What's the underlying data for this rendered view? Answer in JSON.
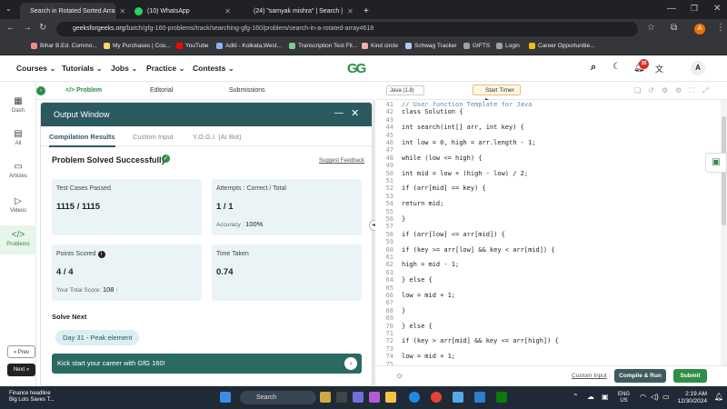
{
  "browser": {
    "tabs": [
      {
        "label": "Search in Rotated Sorted Arra",
        "icon": "gfg-favicon-icon",
        "active": true
      },
      {
        "label": "(10) WhatsApp",
        "icon": "whatsapp-icon",
        "active": false
      },
      {
        "label": "(24) \"samyak mishra\" | Search |",
        "icon": "linkedin-icon",
        "active": false
      }
    ],
    "new_tab": "+",
    "url_host": "geeksforgeeks.org",
    "url_path": "/batch/gfg-160-problems/track/searching-gfg-160/problem/search-in-a-rotated-array4618",
    "profile_initial": "A",
    "bookmarks": [
      "Bihar B.Ed. Commo...",
      "My Purchases | Cou...",
      "YouTube",
      "Aditi - Kolkata,West...",
      "Transcription Test Fil...",
      "Kind circle",
      "Schwag Tracker",
      "GIFTS",
      "Login",
      "Career Opportunitie..."
    ]
  },
  "header": {
    "menus": [
      "Courses ⌄",
      "Tutorials ⌄",
      "Jobs ⌄",
      "Practice ⌄",
      "Contests ⌄"
    ],
    "logo": "GG",
    "notif_count": "35",
    "avatar": "A"
  },
  "rail": {
    "items": [
      {
        "label": "Dash",
        "icon": "▦"
      },
      {
        "label": "All",
        "icon": "▤"
      },
      {
        "label": "Articles",
        "icon": "▭"
      },
      {
        "label": "Videos",
        "icon": "▷"
      },
      {
        "label": "Problems",
        "icon": "</>"
      }
    ],
    "prev": "« Prev",
    "next": "Next »"
  },
  "problem_tabs": [
    "</> Problem",
    "Editorial",
    "Submissions"
  ],
  "output": {
    "title": "Output Window",
    "tabs": [
      "Compilation Results",
      "Custom Input",
      "Y.O.G.I. (AI Bot)"
    ],
    "status": "Problem Solved Successfully",
    "feedback": "Suggest Feedback",
    "test_cases_label": "Test Cases Passed",
    "test_cases_value": "1115 / 1115",
    "attempts_label": "Attempts : Correct / Total",
    "attempts_value": "1 / 1",
    "accuracy_label": "Accuracy :",
    "accuracy_value": "100%",
    "points_label": "Points Scored",
    "points_value": "4 / 4",
    "total_score_label": "Your Total Score:",
    "total_score_value": "108",
    "time_label": "Time Taken",
    "time_value": "0.74",
    "solve_next": "Solve Next",
    "next_problem": "Day 31 - Peak element",
    "banner": "Kick start your career with GfG 160!"
  },
  "editor": {
    "language": "Java (1.8)",
    "timer": "Start Timer",
    "lines": [
      {
        "n": "41",
        "t": "// User function Template for Java",
        "c": true
      },
      {
        "n": "42",
        "t": "class Solution {"
      },
      {
        "n": "43",
        "t": ""
      },
      {
        "n": "44",
        "t": "int search(int[] arr, int key) {"
      },
      {
        "n": "45",
        "t": ""
      },
      {
        "n": "46",
        "t": "int low = 0, high = arr.length - 1;"
      },
      {
        "n": "47",
        "t": ""
      },
      {
        "n": "48",
        "t": "while (low <= high) {"
      },
      {
        "n": "49",
        "t": ""
      },
      {
        "n": "50",
        "t": "int mid = low + (high - low) / 2;"
      },
      {
        "n": "51",
        "t": ""
      },
      {
        "n": "52",
        "t": "if (arr[mid] == key) {"
      },
      {
        "n": "53",
        "t": ""
      },
      {
        "n": "54",
        "t": "return mid;"
      },
      {
        "n": "55",
        "t": ""
      },
      {
        "n": "56",
        "t": "}"
      },
      {
        "n": "57",
        "t": ""
      },
      {
        "n": "58",
        "t": "if (arr[low] <= arr[mid]) {"
      },
      {
        "n": "59",
        "t": ""
      },
      {
        "n": "60",
        "t": "if (key >= arr[low] && key < arr[mid]) {"
      },
      {
        "n": "61",
        "t": ""
      },
      {
        "n": "62",
        "t": "high = mid - 1;"
      },
      {
        "n": "63",
        "t": ""
      },
      {
        "n": "64",
        "t": "} else {"
      },
      {
        "n": "65",
        "t": ""
      },
      {
        "n": "66",
        "t": "low = mid + 1;"
      },
      {
        "n": "67",
        "t": ""
      },
      {
        "n": "68",
        "t": "}"
      },
      {
        "n": "69",
        "t": ""
      },
      {
        "n": "70",
        "t": "} else {"
      },
      {
        "n": "71",
        "t": ""
      },
      {
        "n": "72",
        "t": "if (key > arr[mid] && key <= arr[high]) {"
      },
      {
        "n": "73",
        "t": ""
      },
      {
        "n": "74",
        "t": "low = mid + 1;"
      },
      {
        "n": "75",
        "t": ""
      }
    ],
    "custom_input": "Custom Input",
    "compile_run": "Compile & Run",
    "submit": "Submit"
  },
  "taskbar": {
    "news_title": "Finance headline",
    "news_sub": "Big Lots Saves T...",
    "search": "Search",
    "lang_1": "ENG",
    "lang_2": "US",
    "time": "2:19 AM",
    "date": "12/30/2024"
  },
  "colors": {
    "brand": "#2f8d46",
    "output_header": "#2b5a5e"
  }
}
